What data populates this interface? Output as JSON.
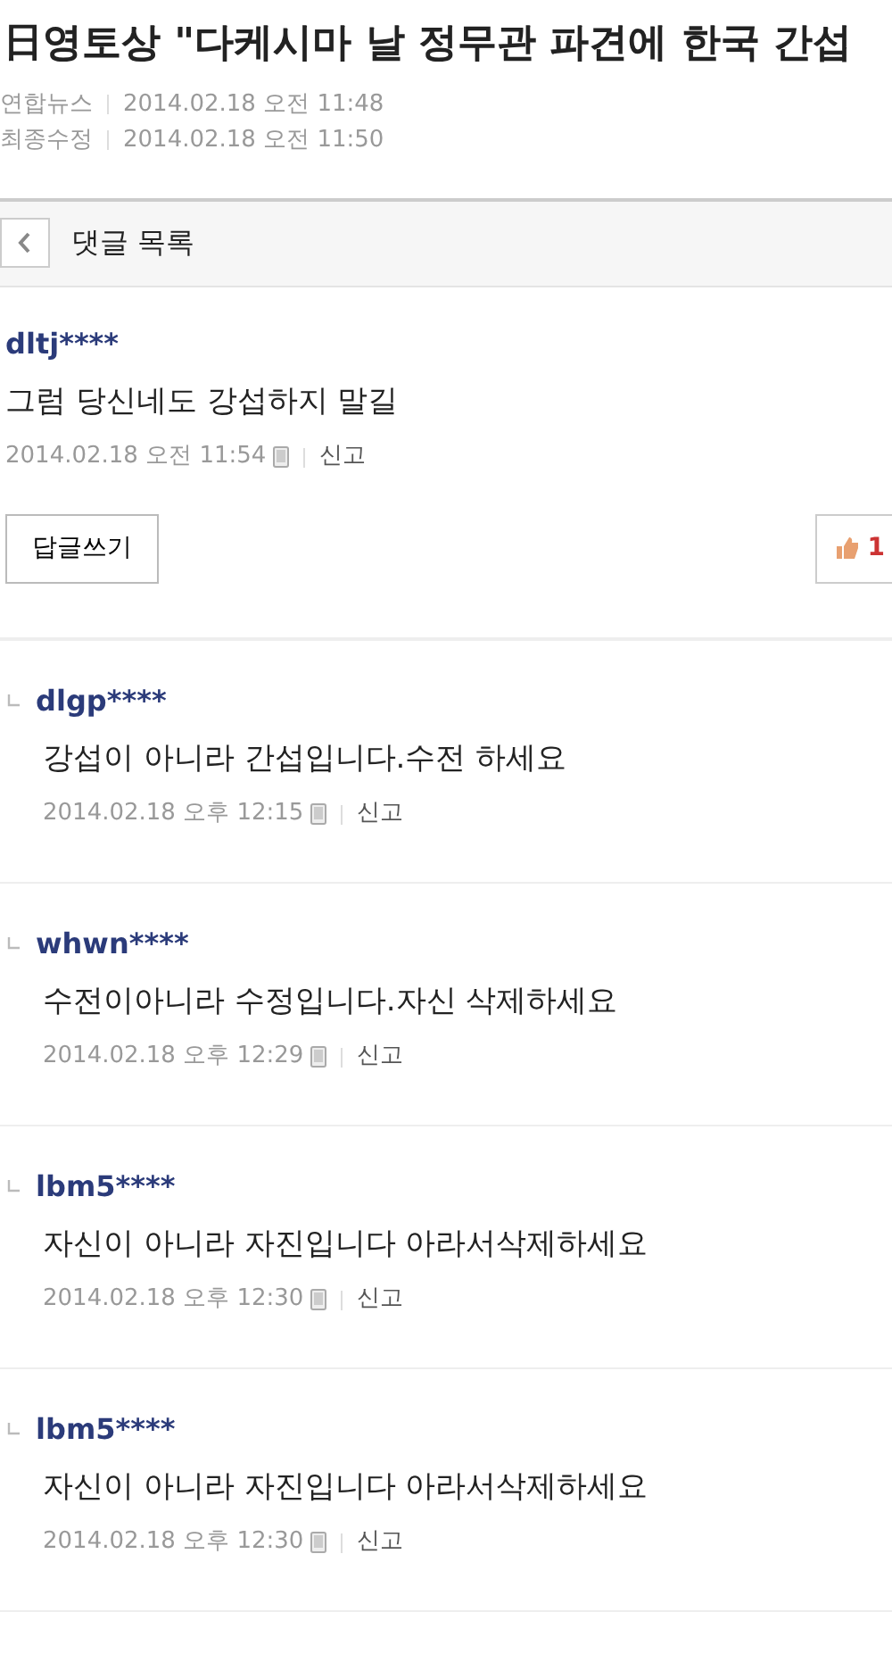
{
  "article": {
    "title": "日영토상 \"다케시마 날 정무관 파견에 한국 간섭",
    "meta": [
      {
        "label": "연합뉴스",
        "value": "2014.02.18 오전 11:48"
      },
      {
        "label": "최종수정",
        "value": "2014.02.18 오전 11:50"
      }
    ]
  },
  "back_bar": {
    "label": "댓글 목록"
  },
  "comment": {
    "user": "dltj****",
    "text": "그럼 당신네도 강섭하지 말길",
    "time": "2014.02.18 오전 11:54",
    "report": "신고",
    "reply_button": "답글쓰기",
    "like_count": "1"
  },
  "replies": [
    {
      "user": "dlgp****",
      "text": "강섭이 아니라 간섭입니다.수전 하세요",
      "time": "2014.02.18 오후 12:15",
      "report": "신고"
    },
    {
      "user": "whwn****",
      "text": "수전이아니라 수정입니다.자신 삭제하세요",
      "time": "2014.02.18 오후 12:29",
      "report": "신고"
    },
    {
      "user": "lbm5****",
      "text": "자신이 아니라 자진입니다 아라서삭제하세요",
      "time": "2014.02.18 오후 12:30",
      "report": "신고"
    },
    {
      "user": "lbm5****",
      "text": "자신이 아니라 자진입니다 아라서삭제하세요",
      "time": "2014.02.18 오후 12:30",
      "report": "신고"
    }
  ]
}
